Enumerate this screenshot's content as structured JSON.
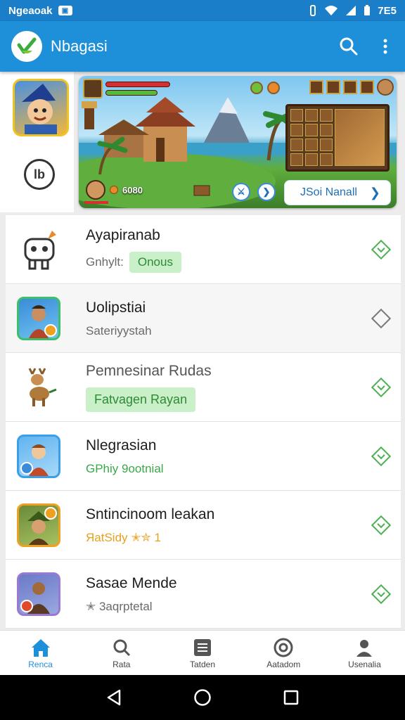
{
  "status_bar": {
    "carrier": "Ngeaoak",
    "time": "7E5"
  },
  "app_bar": {
    "title": "Nbagasi"
  },
  "banner": {
    "score": "6080",
    "cta_label": "JSoi Nanall"
  },
  "list": [
    {
      "title": "Ayapiranab",
      "subtitle": "Gnhylt:",
      "chip": "Onous",
      "action": "diamond-check",
      "icon": "robot-mascot-icon"
    },
    {
      "title": "Uolipstiai",
      "subtitle": "Sateriyystah",
      "chip": "",
      "action": "diamond-empty",
      "icon": "warrior-icon"
    },
    {
      "title": "Pemnesinar Rudas",
      "subtitle": "",
      "chip": "Fatvagen Rayan",
      "action": "diamond-check",
      "icon": "deer-icon"
    },
    {
      "title": "Nlegrasian",
      "subtitle": "GPhiy 9ootnial",
      "chip": "",
      "action": "diamond-check",
      "icon": "adventurer-icon"
    },
    {
      "title": "Sntincinoom leakan",
      "subtitle": "ЯatSidy ✭✮ 1",
      "chip": "",
      "action": "diamond-check",
      "icon": "ranger-icon"
    },
    {
      "title": "Sasae Mende",
      "subtitle": "✭ 3aqrptetal",
      "chip": "",
      "action": "diamond-check",
      "icon": "fighter-icon"
    }
  ],
  "bottom_nav": [
    {
      "label": "Renca",
      "icon": "home-icon",
      "active": true
    },
    {
      "label": "Rata",
      "icon": "search-icon",
      "active": false
    },
    {
      "label": "Tatden",
      "icon": "list-icon",
      "active": false
    },
    {
      "label": "Aatadom",
      "icon": "target-icon",
      "active": false
    },
    {
      "label": "Usenalia",
      "icon": "profile-icon",
      "active": false
    }
  ],
  "colors": {
    "primary": "#1e8fd9",
    "status_bar": "#1a7ec8",
    "accent_green": "#4caf50",
    "chip_bg": "#c9f0c8"
  }
}
